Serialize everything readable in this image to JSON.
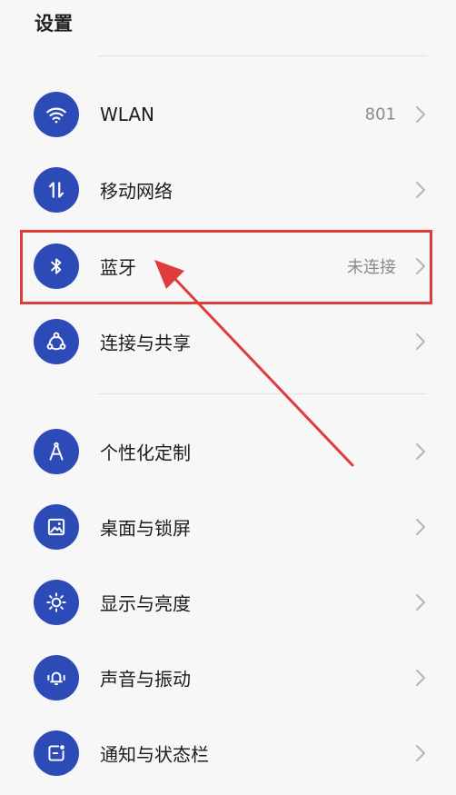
{
  "header": {
    "title": "设置"
  },
  "rows": [
    {
      "label": "WLAN",
      "value": "801",
      "icon": "wifi-icon"
    },
    {
      "label": "移动网络",
      "value": "",
      "icon": "mobile-data-icon"
    },
    {
      "label": "蓝牙",
      "value": "未连接",
      "icon": "bluetooth-icon"
    },
    {
      "label": "连接与共享",
      "value": "",
      "icon": "share-icon"
    },
    {
      "label": "个性化定制",
      "value": "",
      "icon": "compass-icon"
    },
    {
      "label": "桌面与锁屏",
      "value": "",
      "icon": "wallpaper-icon"
    },
    {
      "label": "显示与亮度",
      "value": "",
      "icon": "brightness-icon"
    },
    {
      "label": "声音与振动",
      "value": "",
      "icon": "bell-vibrate-icon"
    },
    {
      "label": "通知与状态栏",
      "value": "",
      "icon": "notification-icon"
    }
  ],
  "annotation": {
    "highlight_color": "#e03c3c"
  },
  "colors": {
    "icon_bg": "#2d4bb7",
    "background": "#f7f7f7"
  }
}
